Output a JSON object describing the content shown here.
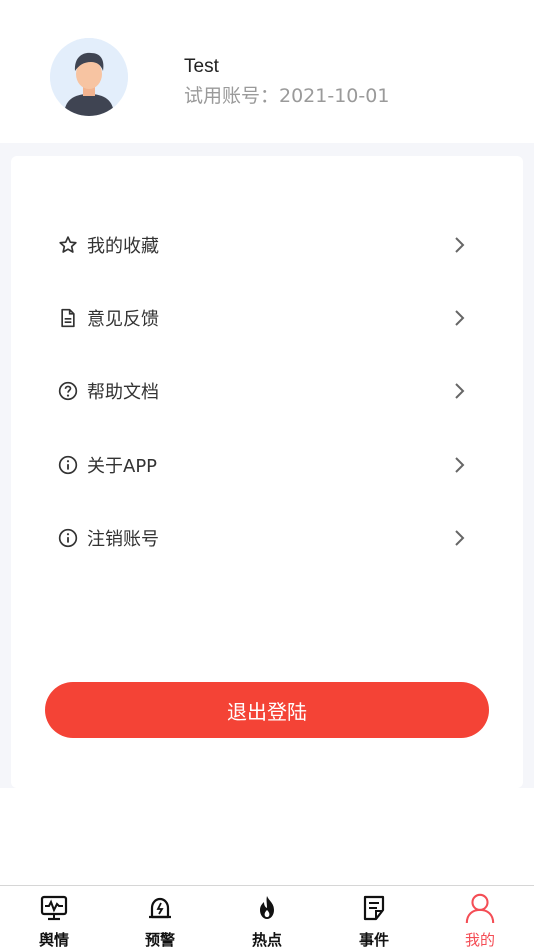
{
  "profile": {
    "name": "Test",
    "trial_text": "试用账号：2021-10-01"
  },
  "menu": [
    {
      "icon": "star-icon",
      "label": "我的收藏"
    },
    {
      "icon": "document-icon",
      "label": "意见反馈"
    },
    {
      "icon": "help-circle-icon",
      "label": "帮助文档"
    },
    {
      "icon": "info-circle-icon",
      "label": "关于APP"
    },
    {
      "icon": "info-circle-icon",
      "label": "注销账号"
    }
  ],
  "logout_label": "退出登陆",
  "tabs": [
    {
      "icon": "monitor-pulse-icon",
      "label": "舆情"
    },
    {
      "icon": "alert-bell-icon",
      "label": "预警"
    },
    {
      "icon": "fire-icon",
      "label": "热点"
    },
    {
      "icon": "note-icon",
      "label": "事件"
    },
    {
      "icon": "user-icon",
      "label": "我的",
      "active": true
    }
  ],
  "colors": {
    "accent": "#f44336",
    "tab_active": "#f44d55",
    "page_bg": "#f5f6fa"
  }
}
